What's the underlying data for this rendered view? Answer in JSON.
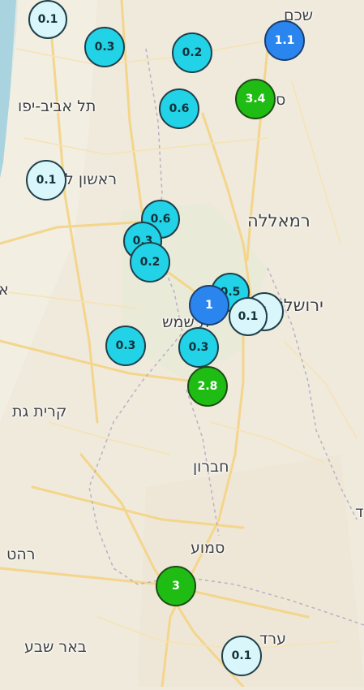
{
  "map": {
    "colors": {
      "land": "#efeadc",
      "sea": "#a9d3df",
      "roads": "#f4d58c",
      "border": "#b9b0c4",
      "marker_cyan": "#22d2e6",
      "marker_pale": "#d9f7fb",
      "marker_blue": "#2a86ee",
      "marker_green": "#1fbd14"
    },
    "places": [
      {
        "id": "shechem",
        "name": "שכם"
      },
      {
        "id": "tel-aviv",
        "name": "תל אביב-יפו"
      },
      {
        "id": "salfit-partial",
        "name": "ס"
      },
      {
        "id": "rishon",
        "name": "ראשון ל"
      },
      {
        "id": "ramallah",
        "name": "רמאללה"
      },
      {
        "id": "jerusalem",
        "name": "ירושלי"
      },
      {
        "id": "beit-shemesh",
        "name": "ית שמש"
      },
      {
        "id": "kiryat-gat",
        "name": "קרית גת"
      },
      {
        "id": "hebron",
        "name": "חברון"
      },
      {
        "id": "samua",
        "name": "סמוע"
      },
      {
        "id": "rahat",
        "name": "רהט"
      },
      {
        "id": "beer-sheva",
        "name": "באר שבע"
      },
      {
        "id": "arad",
        "name": "ערד"
      },
      {
        "id": "left-edge-a",
        "name": "א"
      },
      {
        "id": "right-edge-d",
        "name": "ד"
      }
    ],
    "markers": [
      {
        "id": "m1",
        "value": "0.1",
        "tone": "pale"
      },
      {
        "id": "m2",
        "value": "0.3",
        "tone": "cyan"
      },
      {
        "id": "m3",
        "value": "0.2",
        "tone": "cyan"
      },
      {
        "id": "m4",
        "value": "1.1",
        "tone": "blue"
      },
      {
        "id": "m5",
        "value": "3.4",
        "tone": "green"
      },
      {
        "id": "m6",
        "value": "0.6",
        "tone": "cyan"
      },
      {
        "id": "m7",
        "value": "0.1",
        "tone": "pale"
      },
      {
        "id": "m8",
        "value": "0.6",
        "tone": "cyan"
      },
      {
        "id": "m9",
        "value": "0.3",
        "tone": "cyan"
      },
      {
        "id": "m10",
        "value": "0.2",
        "tone": "cyan"
      },
      {
        "id": "m11",
        "value": "0.5",
        "tone": "cyan"
      },
      {
        "id": "m12",
        "value": "1",
        "tone": "pale"
      },
      {
        "id": "m13",
        "value": "1",
        "tone": "blue"
      },
      {
        "id": "m14",
        "value": "0.1",
        "tone": "pale"
      },
      {
        "id": "m15",
        "value": "0.3",
        "tone": "cyan"
      },
      {
        "id": "m16",
        "value": "0.3",
        "tone": "cyan"
      },
      {
        "id": "m17",
        "value": "2.8",
        "tone": "green"
      },
      {
        "id": "m18",
        "value": "3",
        "tone": "green"
      },
      {
        "id": "m19",
        "value": "0.1",
        "tone": "pale"
      }
    ]
  }
}
